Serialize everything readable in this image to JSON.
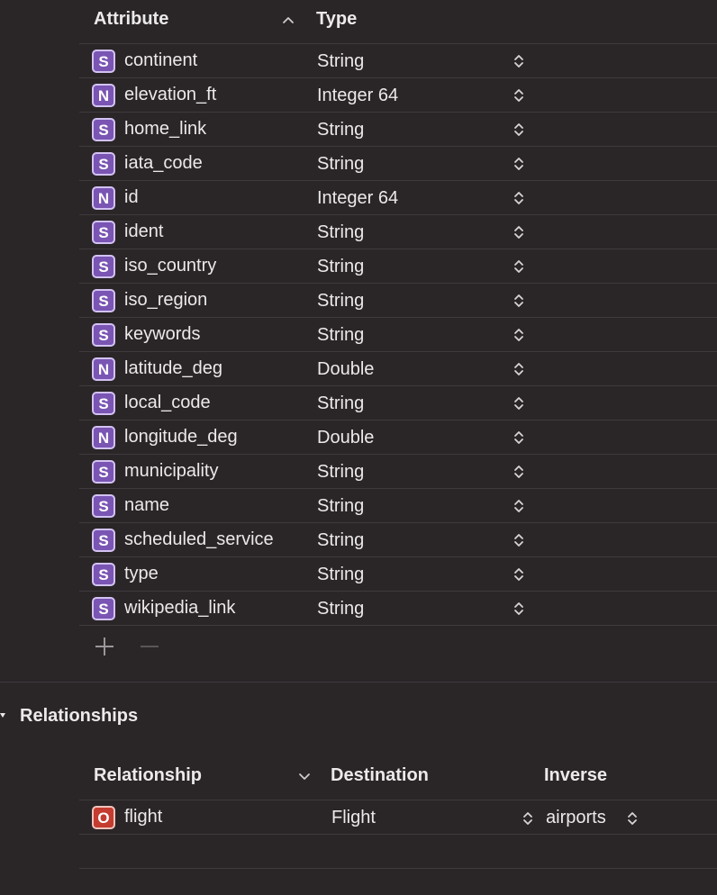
{
  "attributes": {
    "header": {
      "attribute_label": "Attribute",
      "type_label": "Type",
      "sort_icon": "chevron-up-icon"
    },
    "rows": [
      {
        "badge": "S",
        "name": "continent",
        "type": "String"
      },
      {
        "badge": "N",
        "name": "elevation_ft",
        "type": "Integer 64"
      },
      {
        "badge": "S",
        "name": "home_link",
        "type": "String"
      },
      {
        "badge": "S",
        "name": "iata_code",
        "type": "String"
      },
      {
        "badge": "N",
        "name": "id",
        "type": "Integer 64"
      },
      {
        "badge": "S",
        "name": "ident",
        "type": "String"
      },
      {
        "badge": "S",
        "name": "iso_country",
        "type": "String"
      },
      {
        "badge": "S",
        "name": "iso_region",
        "type": "String"
      },
      {
        "badge": "S",
        "name": "keywords",
        "type": "String"
      },
      {
        "badge": "N",
        "name": "latitude_deg",
        "type": "Double"
      },
      {
        "badge": "S",
        "name": "local_code",
        "type": "String"
      },
      {
        "badge": "N",
        "name": "longitude_deg",
        "type": "Double"
      },
      {
        "badge": "S",
        "name": "municipality",
        "type": "String"
      },
      {
        "badge": "S",
        "name": "name",
        "type": "String"
      },
      {
        "badge": "S",
        "name": "scheduled_service",
        "type": "String"
      },
      {
        "badge": "S",
        "name": "type",
        "type": "String"
      },
      {
        "badge": "S",
        "name": "wikipedia_link",
        "type": "String"
      }
    ],
    "add_icon": "plus-icon",
    "remove_icon": "minus-icon"
  },
  "relationships": {
    "section_title": "Relationships",
    "header": {
      "relationship_label": "Relationship",
      "destination_label": "Destination",
      "inverse_label": "Inverse",
      "sort_icon": "chevron-down-icon"
    },
    "rows": [
      {
        "badge": "O",
        "name": "flight",
        "destination": "Flight",
        "inverse": "airports"
      }
    ]
  },
  "colors": {
    "background": "#2a2527",
    "attribute_badge": "#7a55b3",
    "relationship_badge": "#c43c2f",
    "text": "#ece9eb",
    "divider": "#3f3a3d"
  }
}
